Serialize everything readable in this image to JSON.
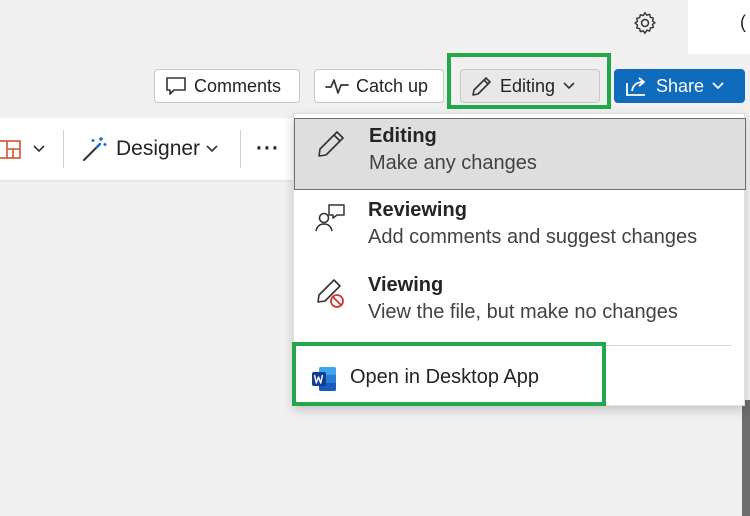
{
  "header": {
    "settings_icon": "gear-icon",
    "edge_glyph": "("
  },
  "toolbar": {
    "comments_label": "Comments",
    "catchup_label": "Catch up",
    "editing_label": "Editing",
    "share_label": "Share"
  },
  "ribbon": {
    "designer_label": "Designer",
    "more_label": "···"
  },
  "mode_menu": {
    "options": [
      {
        "title": "Editing",
        "description": "Make any changes",
        "icon": "pencil-icon",
        "selected": true
      },
      {
        "title": "Reviewing",
        "description": "Add comments and suggest changes",
        "icon": "reviewer-icon",
        "selected": false
      },
      {
        "title": "Viewing",
        "description": "View the file, but make no changes",
        "icon": "no-edit-icon",
        "selected": false
      }
    ],
    "desktop_label": "Open in Desktop App",
    "desktop_icon": "word-icon"
  },
  "colors": {
    "accent": "#0f6cbd",
    "highlight": "#22a84a",
    "selected_bg": "#dedede"
  }
}
